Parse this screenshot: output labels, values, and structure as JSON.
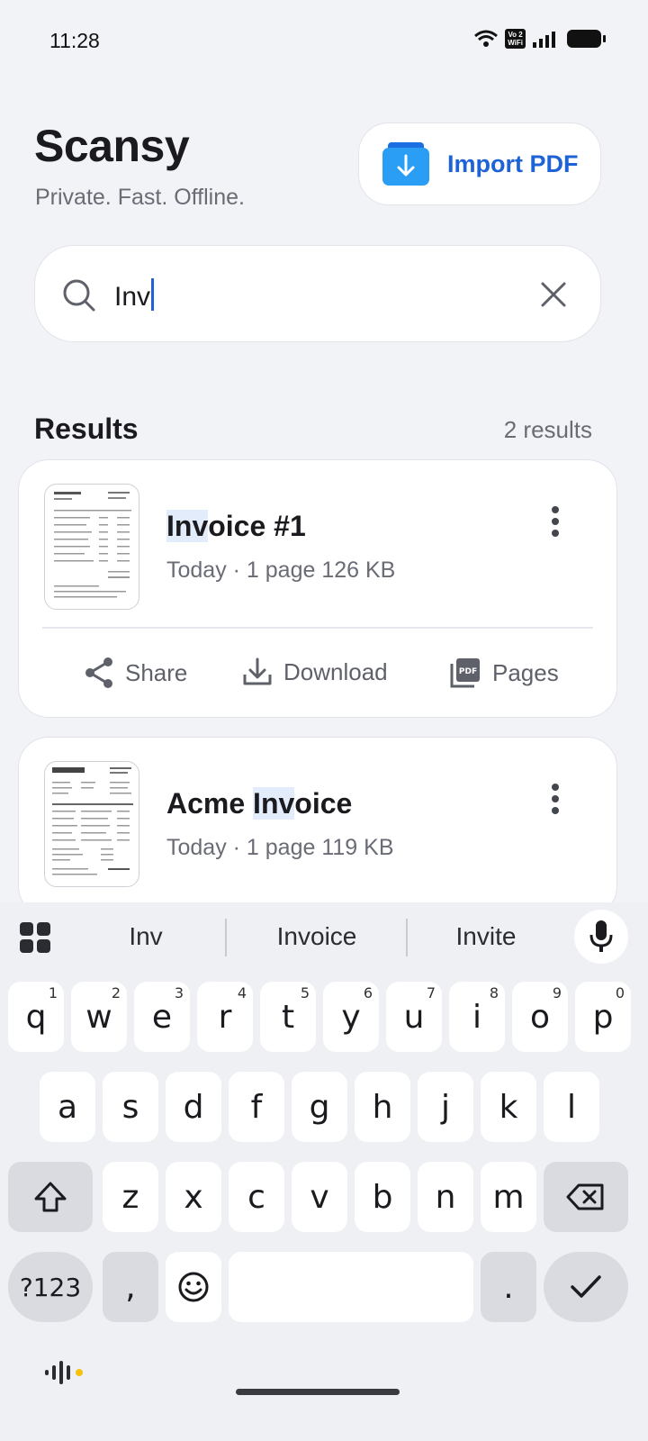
{
  "status": {
    "time": "11:28",
    "network_badge_top": "Vo 2",
    "network_badge_bottom": "WiFi"
  },
  "header": {
    "title": "Scansy",
    "subtitle": "Private. Fast. Offline.",
    "import_label": "Import PDF"
  },
  "search": {
    "value": "Inv"
  },
  "results": {
    "title": "Results",
    "count": "2 results",
    "items": [
      {
        "name_highlight": "Inv",
        "name_rest": "oice #1",
        "meta": "Today · 1 page  126 KB",
        "actions": {
          "share": "Share",
          "download": "Download",
          "pages": "Pages"
        }
      },
      {
        "name_pre": "Acme ",
        "name_highlight": "Inv",
        "name_rest": "oice",
        "meta": "Today · 1 page  119 KB"
      }
    ]
  },
  "keyboard": {
    "suggestions": [
      "Inv",
      "Invoice",
      "Invite"
    ],
    "row1": [
      "q",
      "w",
      "e",
      "r",
      "t",
      "y",
      "u",
      "i",
      "o",
      "p"
    ],
    "row1_numbers": [
      "1",
      "2",
      "3",
      "4",
      "5",
      "6",
      "7",
      "8",
      "9",
      "0"
    ],
    "row2": [
      "a",
      "s",
      "d",
      "f",
      "g",
      "h",
      "j",
      "k",
      "l"
    ],
    "row3": [
      "z",
      "x",
      "c",
      "v",
      "b",
      "n",
      "m"
    ],
    "symbols_label": "?123",
    "comma": ",",
    "period": "."
  },
  "colors": {
    "accent": "#1e63d6",
    "background": "#f2f3f7",
    "highlight": "#e3ecfa"
  }
}
